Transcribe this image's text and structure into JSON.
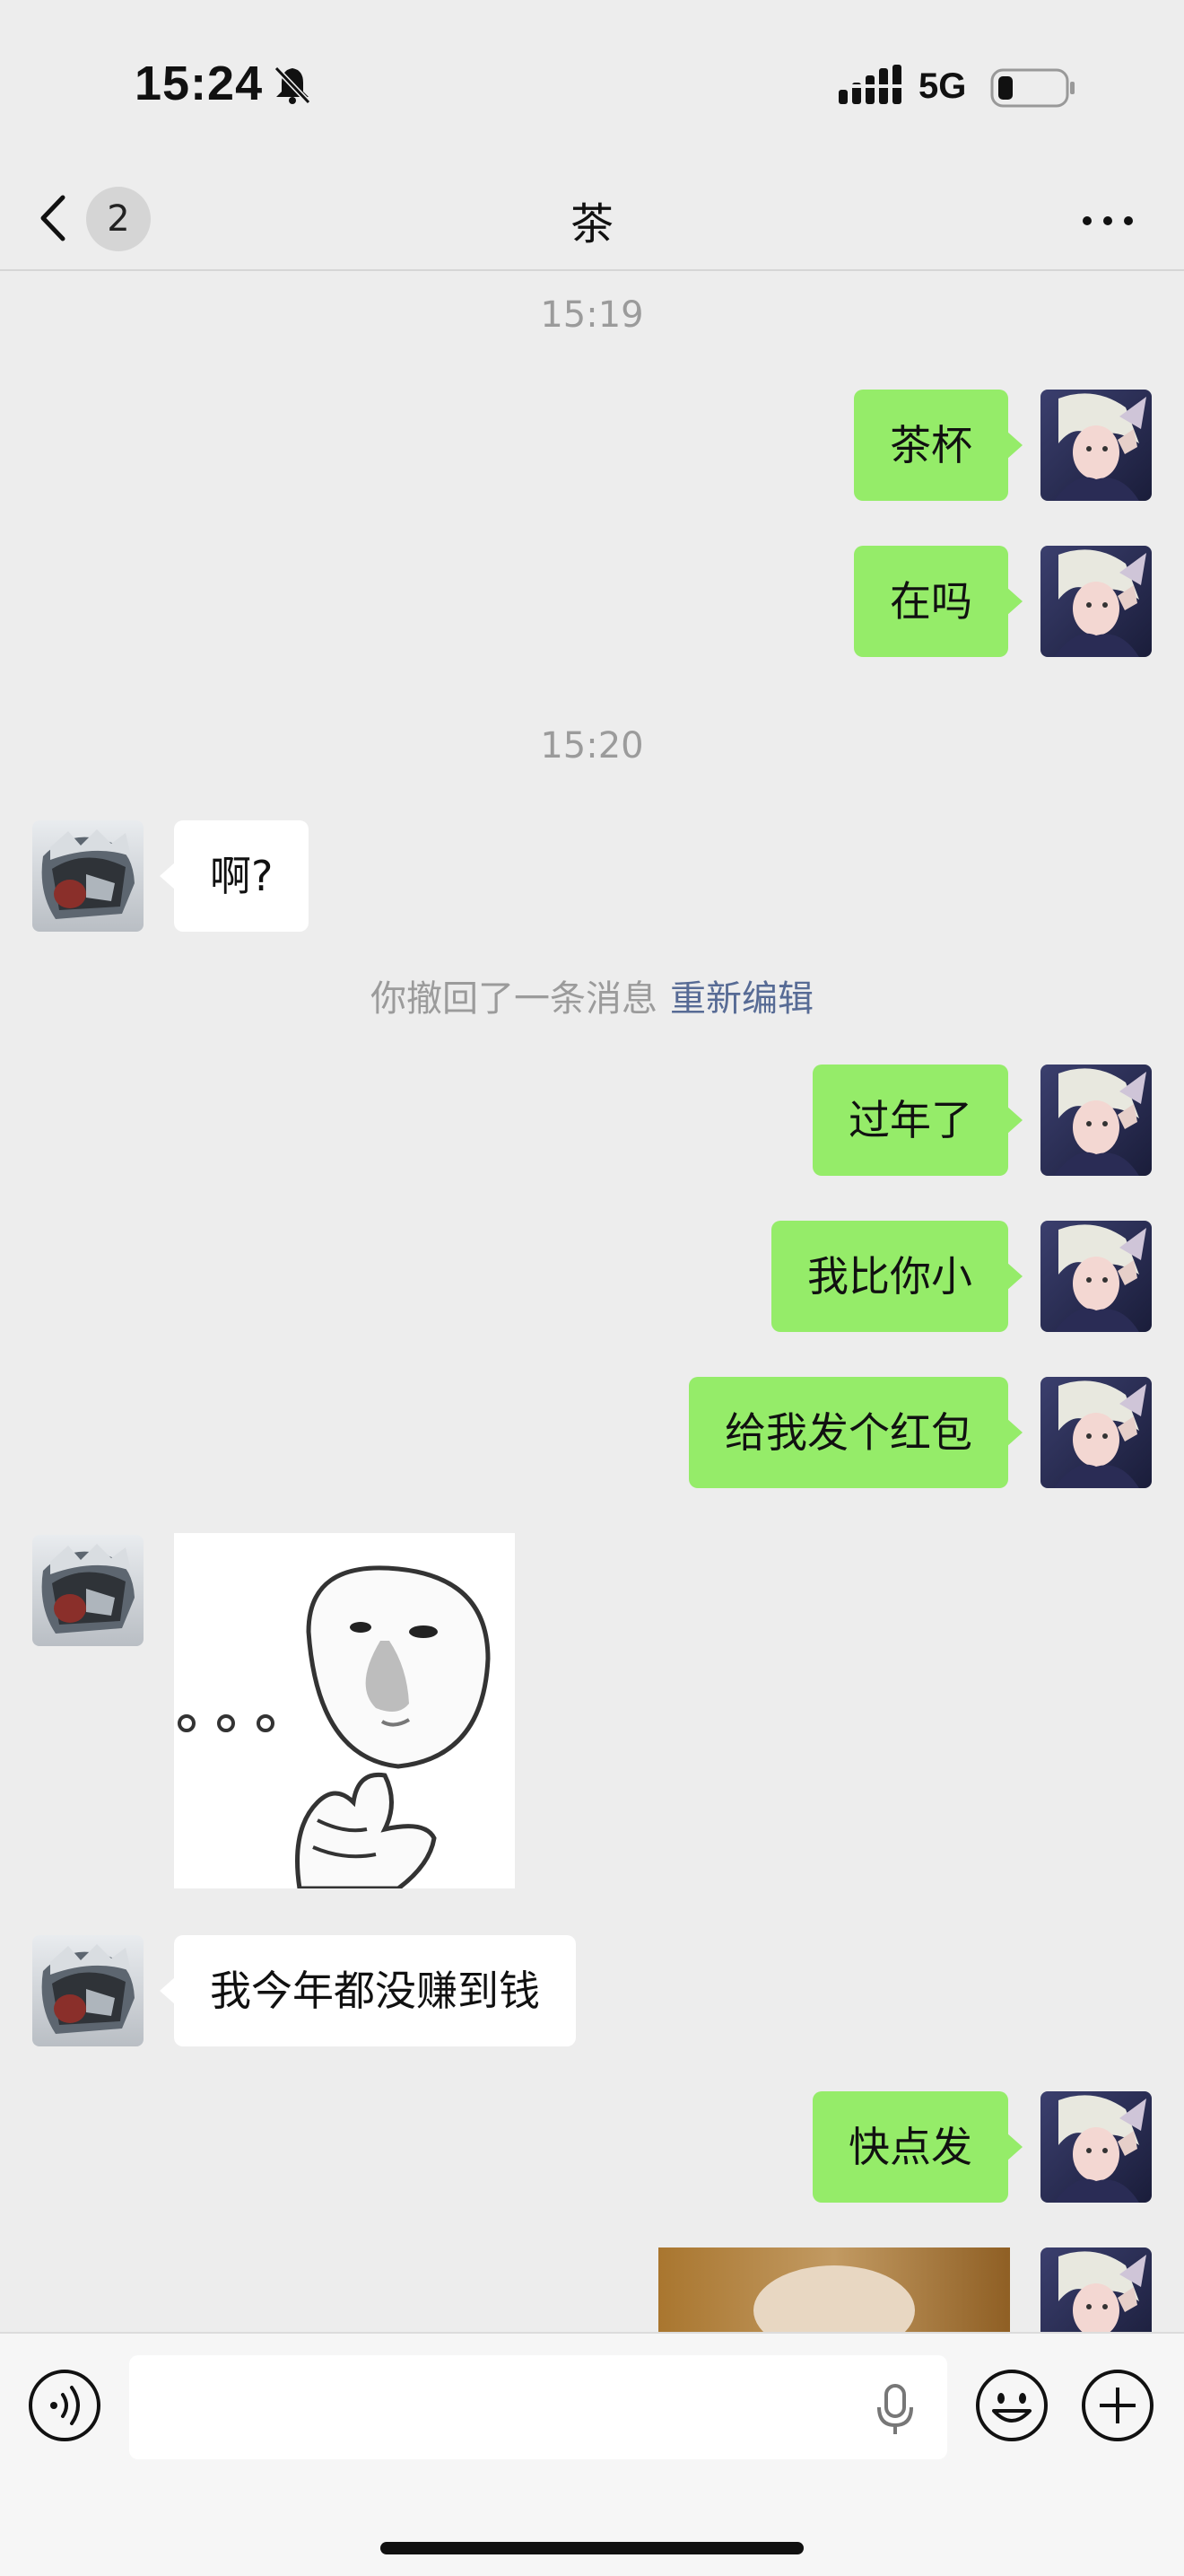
{
  "status_bar": {
    "time": "15:24",
    "network": "5G"
  },
  "nav": {
    "back_count": "2",
    "title": "茶"
  },
  "messages": {
    "ts1": "15:19",
    "m1": "茶杯",
    "m2": "在吗",
    "ts2": "15:20",
    "m3": "啊?",
    "recall_text": "你撤回了一条消息",
    "recall_link": "重新编辑",
    "m4": "过年了",
    "m5": "我比你小",
    "m6": "给我发个红包",
    "m7": "我今年都没赚到钱",
    "m8": "快点发"
  },
  "icons": {
    "status": [
      "bell-off-icon",
      "signal-icon",
      "battery-icon"
    ],
    "nav": [
      "back-chevron-icon",
      "more-icon"
    ],
    "input": [
      "voice-icon",
      "mic-icon",
      "emoji-icon",
      "plus-icon"
    ]
  },
  "colors": {
    "background": "#ededed",
    "my_bubble": "#95ec69",
    "their_bubble": "#ffffff",
    "link": "#576b95"
  }
}
